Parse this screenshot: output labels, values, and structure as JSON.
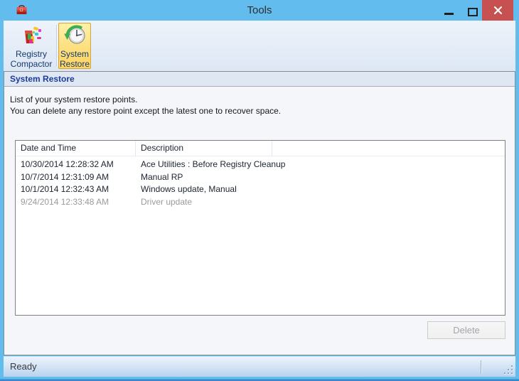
{
  "window": {
    "title": "Tools"
  },
  "icons": {
    "app": "toolbox-icon",
    "minimize": "minimize-icon",
    "maximize": "maximize-icon",
    "close": "close-icon",
    "registry_compactor": "registry-compactor-icon",
    "system_restore": "system-restore-icon",
    "resize_grip": "resize-grip-icon"
  },
  "toolbar": {
    "buttons": [
      {
        "line1": "Registry",
        "line2": "Compactor",
        "selected": false
      },
      {
        "line1": "System",
        "line2": "Restore",
        "selected": true
      }
    ]
  },
  "panel": {
    "header": "System Restore",
    "description": [
      "List of your system restore points.",
      "You can delete any restore point except the latest one to recover space."
    ],
    "table": {
      "columns": [
        "Date and Time",
        "Description"
      ],
      "rows": [
        {
          "date": "10/30/2014 12:28:32 AM",
          "description": "Ace Utilities : Before Registry Cleanup",
          "dimmed": false
        },
        {
          "date": "10/7/2014 12:31:09 AM",
          "description": "Manual RP",
          "dimmed": false
        },
        {
          "date": "10/1/2014 12:32:43 AM",
          "description": "Windows update, Manual",
          "dimmed": false
        },
        {
          "date": "9/24/2014 12:33:48 AM",
          "description": "Driver update",
          "dimmed": true
        }
      ]
    },
    "delete_button": "Delete"
  },
  "statusbar": {
    "text": "Ready"
  },
  "colors": {
    "frame_blue": "#62BDEE",
    "close_button_red": "#C75050",
    "selected_tool_bg": "#FDDF7E",
    "selected_tool_border": "#D9A23A",
    "panel_header_text": "#1B3A9E",
    "dimmed_row_text": "#9B9B9B"
  }
}
